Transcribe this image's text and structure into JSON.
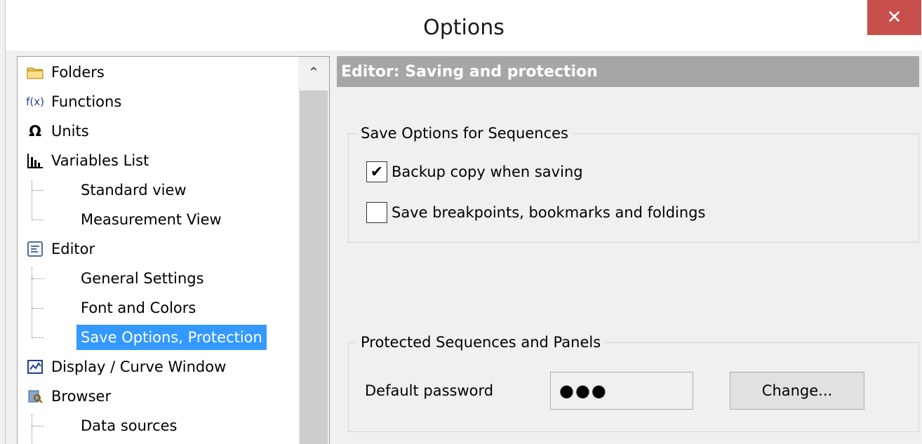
{
  "window": {
    "title": "Options",
    "close_glyph": "✕"
  },
  "tree": {
    "scroll_up_glyph": "⌃",
    "items": [
      {
        "label": "Folders",
        "icon": "folder-icon"
      },
      {
        "label": "Functions",
        "icon": "function-icon",
        "icon_text": "f(x)"
      },
      {
        "label": "Units",
        "icon": "omega-icon",
        "icon_text": "Ω"
      },
      {
        "label": "Variables List",
        "icon": "bar-chart-icon"
      },
      {
        "label": "Standard view"
      },
      {
        "label": "Measurement View"
      },
      {
        "label": "Editor",
        "icon": "editor-icon"
      },
      {
        "label": "General Settings"
      },
      {
        "label": "Font and Colors"
      },
      {
        "label": "Save Options, Protection",
        "selected": true
      },
      {
        "label": "Display / Curve Window",
        "icon": "curve-window-icon"
      },
      {
        "label": "Browser",
        "icon": "browser-icon"
      },
      {
        "label": "Data sources"
      }
    ]
  },
  "panel": {
    "header": "Editor: Saving and protection",
    "save_group": {
      "title": "Save Options for Sequences",
      "backup": {
        "label": "Backup copy when saving",
        "checked": true,
        "check_glyph": "✔"
      },
      "breakpoints": {
        "label": "Save breakpoints, bookmarks and foldings",
        "checked": false
      }
    },
    "protect_group": {
      "title": "Protected Sequences and Panels",
      "password_label": "Default password",
      "password_value": "●●●",
      "change_button": "Change..."
    }
  },
  "colors": {
    "selection": "#3399ff",
    "header_bg": "#a6a6a6",
    "close_bg": "#c7504c"
  }
}
